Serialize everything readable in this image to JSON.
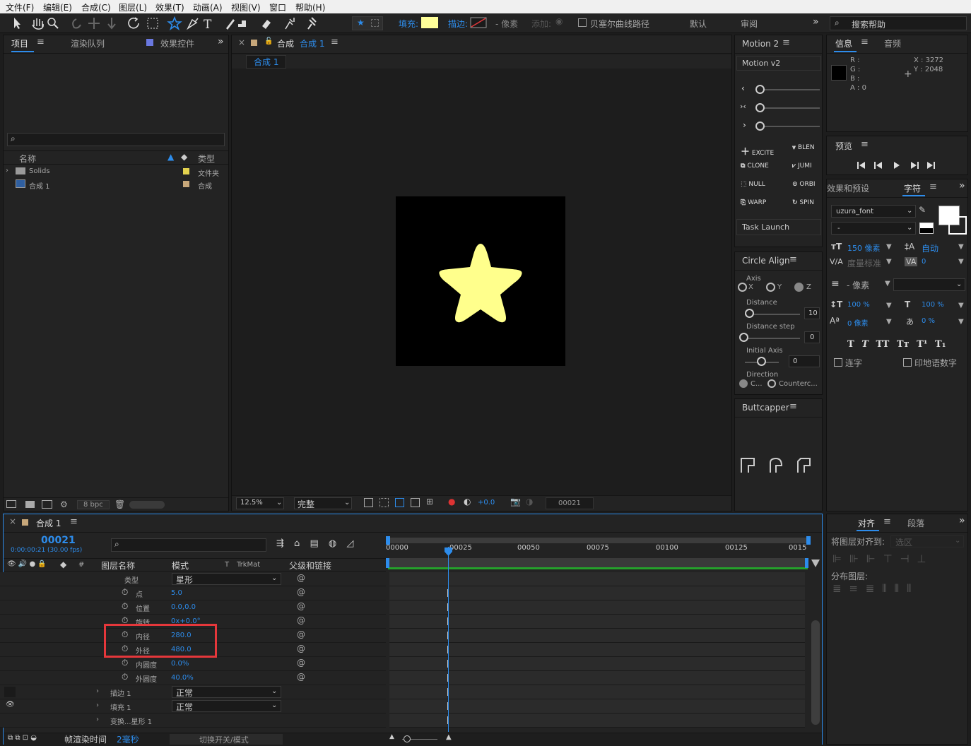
{
  "menu": [
    "文件(F)",
    "编辑(E)",
    "合成(C)",
    "图层(L)",
    "效果(T)",
    "动画(A)",
    "视图(V)",
    "窗口",
    "帮助(H)"
  ],
  "toolbar": {
    "fill_label": "填充:",
    "stroke_label": "描边:",
    "stroke_px": "- 像素",
    "add_label": "添加:",
    "bezier_label": "贝塞尔曲线路径",
    "ws_default": "默认",
    "ws_review": "审阅",
    "search_placeholder": "搜索帮助"
  },
  "colors": {
    "accent": "#2d8ceb",
    "fill_swatch": "#ffff99",
    "star": "#ffff8c",
    "red_highlight": "#e5373b",
    "green_bar": "#25a12b"
  },
  "project": {
    "tabs": [
      "项目",
      "渲染队列",
      "效果控件"
    ],
    "col_name": "名称",
    "col_type": "类型",
    "items": [
      {
        "name": "Solids",
        "type": "文件夹"
      },
      {
        "name": "合成 1",
        "type": "合成"
      }
    ],
    "bpc": "8 bpc"
  },
  "comp": {
    "tab_prefix": "合成",
    "tab_name": "合成 1",
    "subtab": "合成 1",
    "zoom": "12.5%",
    "quality": "完整",
    "exposure": "+0.0",
    "frame": "00021"
  },
  "motion": {
    "title": "Motion 2",
    "version": "Motion v2",
    "buttons": [
      [
        "EXCITE",
        "BLEN"
      ],
      [
        "CLONE",
        "JUMI"
      ],
      [
        "NULL",
        "ORBI"
      ],
      [
        "WARP",
        "SPIN"
      ]
    ],
    "task": "Task Launch"
  },
  "circle_align": {
    "title": "Circle Align",
    "axis": "Axis",
    "x": "X",
    "y": "Y",
    "z": "Z",
    "distance": "Distance",
    "distance_val": "10",
    "step": "Distance step",
    "step_val": "0",
    "initial": "Initial Axis",
    "initial_val": "0",
    "direction": "Direction",
    "dir_c": "C...",
    "dir_cc": "Counterc..."
  },
  "buttcapper": {
    "title": "Buttcapper"
  },
  "info": {
    "tabs": [
      "信息",
      "音频"
    ],
    "r": "R :",
    "g": "G :",
    "b": "B :",
    "a": "A : 0",
    "x": "X : 3272",
    "y": "Y : 2048"
  },
  "preview": {
    "title": "预览"
  },
  "character": {
    "tabs": [
      "效果和预设",
      "字符"
    ],
    "font": "uzura_font",
    "style": "-",
    "size": "150 像素",
    "leading": "自动",
    "kern": "度量标准",
    "track": "0",
    "stroke": "- 像素",
    "vscale": "100 %",
    "hscale": "100 %",
    "baseline": "0 像素",
    "tsume": "0 %",
    "ligature": "连字",
    "hindi": "印地语数字"
  },
  "align": {
    "tabs": [
      "对齐",
      "段落"
    ],
    "align_to": "将图层对齐到:",
    "align_sel": "选区",
    "distribute": "分布图层:"
  },
  "timeline": {
    "tab": "合成 1",
    "timecode": "00021",
    "timecode_sub": "0:00:00:21 (30.00 fps)",
    "col_layer": "图层名称",
    "col_mode": "模式",
    "col_t": "T",
    "col_trk": "TrkMat",
    "col_parent": "父级和链接",
    "rows": [
      {
        "label": "类型",
        "value": "星形"
      },
      {
        "label": "点",
        "value": "5.0"
      },
      {
        "label": "位置",
        "value": "0.0,0.0"
      },
      {
        "label": "旋转",
        "value": "0x+0.0°"
      },
      {
        "label": "内径",
        "value": "280.0"
      },
      {
        "label": "外径",
        "value": "480.0"
      },
      {
        "label": "内圆度",
        "value": "0.0%"
      },
      {
        "label": "外圆度",
        "value": "40.0%"
      }
    ],
    "sub": [
      {
        "label": "描边 1",
        "mode": "正常"
      },
      {
        "label": "填充 1",
        "mode": "正常"
      },
      {
        "label": "变换...星形 1",
        "mode": ""
      }
    ],
    "render_label": "帧渲染时间",
    "render_val": "2毫秒",
    "switch_label": "切换开关/模式",
    "ruler": [
      "00000",
      "00025",
      "00050",
      "00075",
      "00100",
      "00125",
      "0015"
    ]
  }
}
